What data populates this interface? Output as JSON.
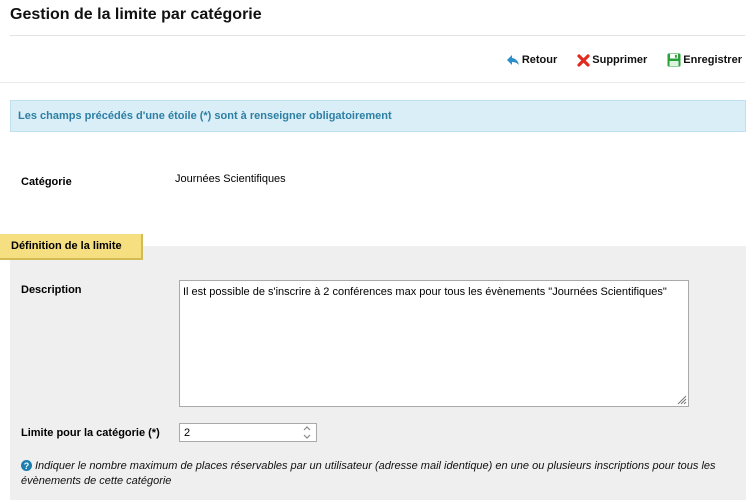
{
  "page": {
    "title": "Gestion de la limite par catégorie"
  },
  "toolbar": {
    "back_label": "Retour",
    "delete_label": "Supprimer",
    "save_label": "Enregistrer"
  },
  "info_banner": {
    "text": "Les champs précédés d'une étoile (*) sont à renseigner obligatoirement"
  },
  "category": {
    "label": "Catégorie",
    "value": "Journées Scientifiques"
  },
  "section": {
    "tab_label": "Définition de la limite",
    "description": {
      "label": "Description",
      "value": "Il est possible de s'inscrire à 2 conférences max pour tous les évènements \"Journées Scientifiques\""
    },
    "limit": {
      "label": "Limite pour la catégorie (*)",
      "value": "2"
    },
    "help_text": "Indiquer le nombre maximum de places réservables par un utilisateur (adresse mail identique) en une ou plusieurs inscriptions pour tous les évènements de cette catégorie"
  },
  "colors": {
    "banner_bg": "#d9eef7",
    "banner_text": "#2d7fa3",
    "tab_bg": "#f5df80",
    "panel_bg": "#efefef",
    "delete_red": "#e02b20",
    "save_green": "#2aa03a",
    "back_blue": "#2a8fc8"
  },
  "icons": {
    "back": "back-arrow-icon",
    "delete": "red-x-icon",
    "save": "floppy-disk-icon",
    "help": "question-circle-icon"
  }
}
